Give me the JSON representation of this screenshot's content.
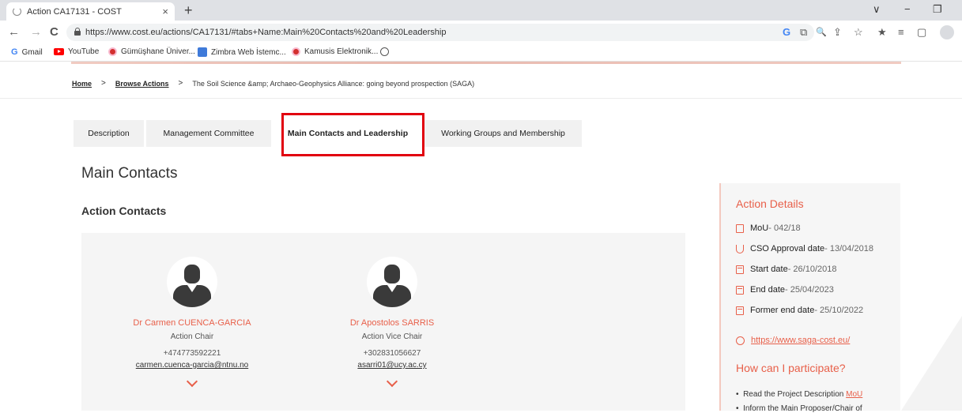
{
  "browser": {
    "tab_title": "Action CA17131 - COST",
    "tab_close": "×",
    "new_tab": "+",
    "url": "https://www.cost.eu/actions/CA17131/#tabs+Name:Main%20Contacts%20and%20Leadership",
    "window_controls": [
      "∨",
      "−",
      "❐"
    ],
    "nav": {
      "back": "←",
      "forward": "→",
      "reload": "C"
    },
    "toolbar_icons": [
      "G",
      "⧉",
      "🔍",
      "⇪",
      "☆",
      "★",
      "≡",
      "▢"
    ],
    "bookmarks": [
      {
        "label": "Gmail",
        "icon": "google-icon"
      },
      {
        "label": "YouTube",
        "icon": "youtube-icon"
      },
      {
        "label": "Gümüşhane Üniver...",
        "icon": "university-icon"
      },
      {
        "label": "Zimbra Web İstemc...",
        "icon": "zimbra-icon"
      },
      {
        "label": "Kamusis Elektronik...",
        "icon": "kamusis-icon"
      },
      {
        "label": "",
        "icon": "globe-icon"
      }
    ]
  },
  "breadcrumb": {
    "home": "Home",
    "sep": ">",
    "browse": "Browse Actions",
    "current": "The Soil Science &amp; Archaeo-Geophysics Alliance: going beyond prospection (SAGA)"
  },
  "tabs": [
    {
      "label": "Description"
    },
    {
      "label": "Management Committee"
    },
    {
      "label": "Main Contacts and Leadership"
    },
    {
      "label": "Working Groups and Membership"
    }
  ],
  "main": {
    "heading": "Main Contacts",
    "subheading": "Action Contacts",
    "contacts": [
      {
        "name": "Dr Carmen CUENCA-GARCIA",
        "role": "Action Chair",
        "phone": "+474773592221",
        "email": "carmen.cuenca-garcia@ntnu.no"
      },
      {
        "name": "Dr Apostolos SARRIS",
        "role": "Action Vice Chair",
        "phone": "+302831056627",
        "email": "asarri01@ucy.ac.cy"
      }
    ]
  },
  "details": {
    "title": "Action Details",
    "rows": [
      {
        "key": "MoU",
        "value": " - 042/18"
      },
      {
        "key": "CSO Approval date",
        "value": " - 13/04/2018"
      },
      {
        "key": "Start date",
        "value": " - 26/10/2018"
      },
      {
        "key": "End date",
        "value": " - 25/04/2023"
      },
      {
        "key": "Former end date",
        "value": " - 25/10/2022"
      }
    ],
    "website": "https://www.saga-cost.eu/",
    "participate_title": "How can I participate?",
    "bullet_1_text": "Read the Project Description ",
    "bullet_1_link": "MoU",
    "bullet_2_text": "Inform the Main Proposer/Chair of"
  },
  "colors": {
    "accent": "#e8604a",
    "highlight": "#e1000f"
  }
}
